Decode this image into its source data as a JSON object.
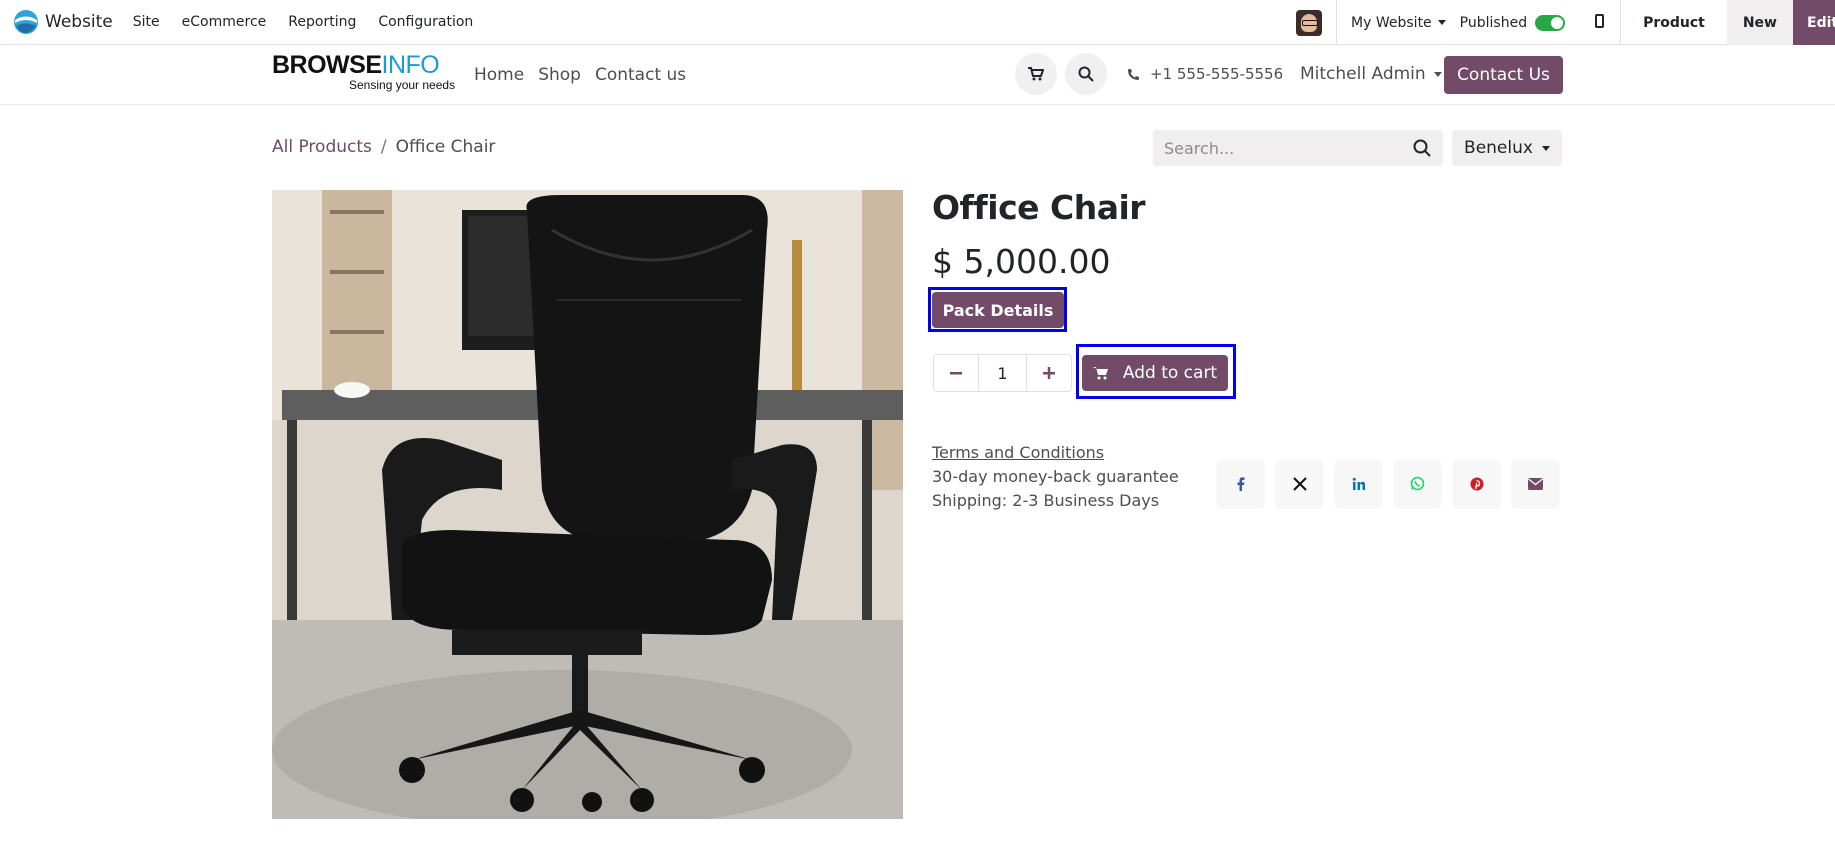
{
  "adminbar": {
    "app_name": "Website",
    "menu": [
      "Site",
      "eCommerce",
      "Reporting",
      "Configuration"
    ],
    "website_selector": "My Website",
    "published_label": "Published",
    "published": true,
    "product_label": "Product",
    "new_label": "New",
    "edit_label": "Edit"
  },
  "header": {
    "logo_main": "BROWSE",
    "logo_accent": "INFO",
    "logo_tagline": "Sensing your needs",
    "nav": [
      "Home",
      "Shop",
      "Contact us"
    ],
    "phone": "+1 555-555-5556",
    "user": "Mitchell Admin",
    "contact_button": "Contact Us"
  },
  "breadcrumb": {
    "parent": "All Products",
    "separator": "/",
    "current": "Office Chair"
  },
  "search": {
    "placeholder": "Search..."
  },
  "pricelist": "Benelux",
  "product": {
    "name": "Office Chair",
    "price": "$ 5,000.00",
    "pack_details_label": "Pack Details",
    "quantity": "1",
    "add_to_cart_label": "Add to cart",
    "terms_label": "Terms and Conditions",
    "guarantee": "30-day money-back guarantee",
    "shipping": "Shipping: 2-3 Business Days"
  },
  "share_icons": [
    "facebook-icon",
    "x-icon",
    "linkedin-icon",
    "whatsapp-icon",
    "pinterest-icon",
    "envelope-icon"
  ],
  "colors": {
    "brand": "#714b67",
    "highlight": "#0000ee",
    "toggle_on": "#28a745",
    "logo_accent": "#1a9bd7"
  }
}
